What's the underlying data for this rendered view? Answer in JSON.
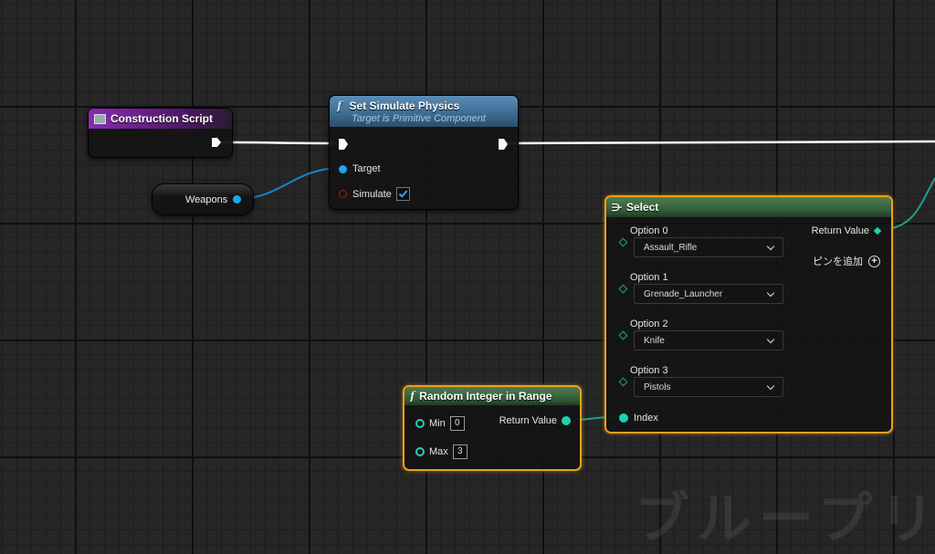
{
  "construction": {
    "title": "Construction Script"
  },
  "weapons": {
    "label": "Weapons"
  },
  "physics": {
    "title": "Set Simulate Physics",
    "subtitle": "Target is Primitive Component",
    "target_label": "Target",
    "simulate_label": "Simulate",
    "simulate_checked": true
  },
  "select": {
    "title": "Select",
    "return_label": "Return Value",
    "add_pin_label": "ピンを追加",
    "index_label": "Index",
    "options": [
      {
        "label": "Option 0",
        "value": "Assault_Rifle"
      },
      {
        "label": "Option 1",
        "value": "Grenade_Launcher"
      },
      {
        "label": "Option 2",
        "value": "Knife"
      },
      {
        "label": "Option 3",
        "value": "Pistols"
      }
    ]
  },
  "random": {
    "title": "Random Integer in Range",
    "min_label": "Min",
    "min_value": "0",
    "max_label": "Max",
    "max_value": "3",
    "return_label": "Return Value"
  },
  "watermark": "ブループリント",
  "colors": {
    "object_pin": "#1aa8f0",
    "int_pin": "#1fd1b0",
    "bool_pin": "#a01a1a",
    "exec_wire": "#ffffff",
    "selection": "#e8a21a"
  }
}
